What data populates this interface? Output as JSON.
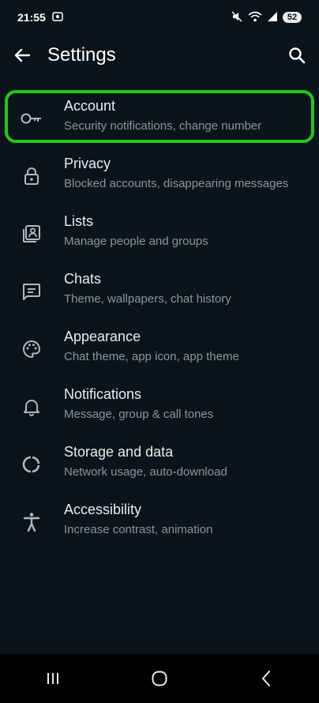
{
  "status_bar": {
    "time": "21:55",
    "battery": "52",
    "icons": [
      "screen-record-icon",
      "mute-icon",
      "wifi-icon",
      "signal-icon"
    ]
  },
  "header": {
    "title": "Settings",
    "back_icon": "arrow-back-icon",
    "search_icon": "search-icon"
  },
  "settings": {
    "items": [
      {
        "label": "Account",
        "subtitle": "Security notifications, change number",
        "icon": "key-icon",
        "highlighted": true
      },
      {
        "label": "Privacy",
        "subtitle": "Blocked accounts, disappearing messages",
        "icon": "lock-icon"
      },
      {
        "label": "Lists",
        "subtitle": "Manage people and groups",
        "icon": "contacts-list-icon"
      },
      {
        "label": "Chats",
        "subtitle": "Theme, wallpapers, chat history",
        "icon": "chat-icon"
      },
      {
        "label": "Appearance",
        "subtitle": "Chat theme, app icon, app theme",
        "icon": "palette-icon"
      },
      {
        "label": "Notifications",
        "subtitle": "Message, group & call tones",
        "icon": "bell-icon"
      },
      {
        "label": "Storage and data",
        "subtitle": "Network usage, auto-download",
        "icon": "storage-circle-icon"
      },
      {
        "label": "Accessibility",
        "subtitle": "Increase contrast, animation",
        "icon": "accessibility-icon"
      }
    ]
  },
  "nav_bar": {
    "icons": [
      "recent-apps-icon",
      "home-icon",
      "back-nav-icon"
    ]
  },
  "colors": {
    "background": "#0b141a",
    "highlight": "#22c81b",
    "primary_text": "#e9edef",
    "secondary_text": "#8696a0"
  }
}
